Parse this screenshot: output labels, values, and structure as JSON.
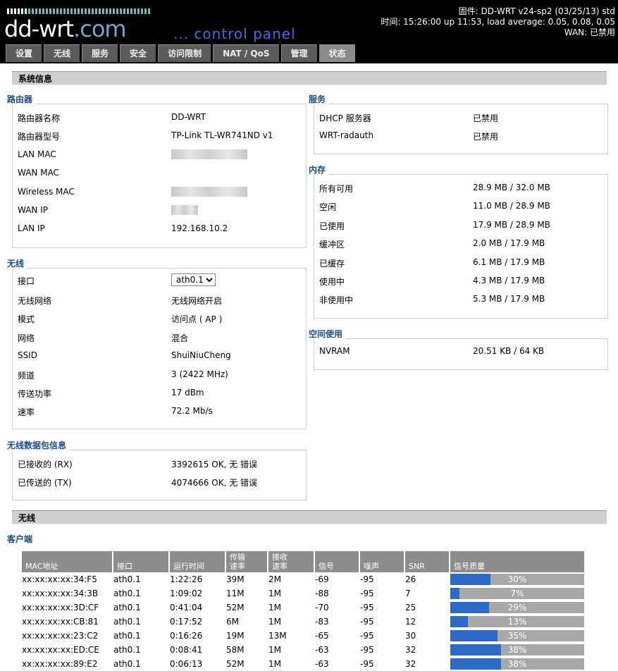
{
  "header": {
    "logo_main": "dd-wrt",
    "logo_com": ".com",
    "subtitle": "... control panel",
    "firmware": "固件: DD-WRT v24-sp2 (03/25/13) std",
    "time": "时间: 15:26:00 up 11:53, load average: 0.05, 0.08, 0.05",
    "wan": "WAN: 已禁用"
  },
  "tabs": [
    "设置",
    "无线",
    "服务",
    "安全",
    "访问限制",
    "NAT / QoS",
    "管理",
    "状态"
  ],
  "system_info_title": "系统信息",
  "router": {
    "title": "路由器",
    "rows": [
      {
        "k": "路由器名称",
        "v": "DD-WRT"
      },
      {
        "k": "路由器型号",
        "v": "TP-Link TL-WR741ND v1"
      },
      {
        "k": "LAN MAC",
        "v": ""
      },
      {
        "k": "WAN MAC",
        "v": ""
      },
      {
        "k": "Wireless MAC",
        "v": ""
      },
      {
        "k": "WAN IP",
        "v": ""
      },
      {
        "k": "LAN IP",
        "v": "192.168.10.2"
      }
    ]
  },
  "wireless": {
    "title": "无线",
    "interface_label": "接口",
    "interface_value": "ath0.1",
    "rows": [
      {
        "k": "无线网络",
        "v": "无线网络开启"
      },
      {
        "k": "模式",
        "v": "访问点 ( AP )"
      },
      {
        "k": "网络",
        "v": "混合"
      },
      {
        "k": "SSID",
        "v": "ShuiNiuCheng"
      },
      {
        "k": "频道",
        "v": "3 (2422 MHz)"
      },
      {
        "k": "传送功率",
        "v": "17 dBm"
      },
      {
        "k": "速率",
        "v": "72.2 Mb/s"
      }
    ]
  },
  "packets": {
    "title": "无线数据包信息",
    "rows": [
      {
        "k": "已接收的 (RX)",
        "v": "3392615 OK, 无 错误"
      },
      {
        "k": "已传送的 (TX)",
        "v": "4074666 OK, 无 错误"
      }
    ]
  },
  "services": {
    "title": "服务",
    "rows": [
      {
        "k": "DHCP 服务器",
        "v": "已禁用"
      },
      {
        "k": "WRT-radauth",
        "v": "已禁用"
      }
    ]
  },
  "memory": {
    "title": "内存",
    "rows": [
      {
        "k": "所有可用",
        "v": "28.9 MB / 32.0 MB"
      },
      {
        "k": "空闲",
        "v": "11.0 MB / 28.9 MB"
      },
      {
        "k": "已使用",
        "v": "17.9 MB / 28.9 MB"
      },
      {
        "k": "缓冲区",
        "v": "2.0 MB / 17.9 MB"
      },
      {
        "k": "已缓存",
        "v": "6.1 MB / 17.9 MB"
      },
      {
        "k": "使用中",
        "v": "4.3 MB / 17.9 MB"
      },
      {
        "k": "非使用中",
        "v": "5.3 MB / 17.9 MB"
      }
    ]
  },
  "space": {
    "title": "空间使用",
    "rows": [
      {
        "k": "NVRAM",
        "v": "20.51 KB / 64 KB"
      }
    ]
  },
  "wireless_section_title": "无线",
  "clients": {
    "title": "客户端",
    "columns": [
      "MAC地址",
      "接口",
      "运行时间",
      "传输\n速率",
      "接收\n速率",
      "信号",
      "噪声",
      "SNR",
      "信号质量"
    ],
    "rows": [
      {
        "mac": "xx:xx:xx:xx:34:F5",
        "iface": "ath0.1",
        "uptime": "1:22:26",
        "tx": "39M",
        "rx": "2M",
        "signal": "-69",
        "noise": "-95",
        "snr": "26",
        "quality": 30
      },
      {
        "mac": "xx:xx:xx:xx:34:3B",
        "iface": "ath0.1",
        "uptime": "1:09:02",
        "tx": "11M",
        "rx": "1M",
        "signal": "-88",
        "noise": "-95",
        "snr": "7",
        "quality": 7
      },
      {
        "mac": "xx:xx:xx:xx:3D:CF",
        "iface": "ath0.1",
        "uptime": "0:41:04",
        "tx": "52M",
        "rx": "1M",
        "signal": "-70",
        "noise": "-95",
        "snr": "25",
        "quality": 29
      },
      {
        "mac": "xx:xx:xx:xx:CB:81",
        "iface": "ath0.1",
        "uptime": "0:17:52",
        "tx": "6M",
        "rx": "1M",
        "signal": "-83",
        "noise": "-95",
        "snr": "12",
        "quality": 13
      },
      {
        "mac": "xx:xx:xx:xx:23:C2",
        "iface": "ath0.1",
        "uptime": "0:16:26",
        "tx": "19M",
        "rx": "13M",
        "signal": "-65",
        "noise": "-95",
        "snr": "30",
        "quality": 35
      },
      {
        "mac": "xx:xx:xx:xx:ED:CE",
        "iface": "ath0.1",
        "uptime": "0:08:41",
        "tx": "58M",
        "rx": "1M",
        "signal": "-63",
        "noise": "-95",
        "snr": "32",
        "quality": 38
      },
      {
        "mac": "xx:xx:xx:xx:89:E2",
        "iface": "ath0.1",
        "uptime": "0:06:13",
        "tx": "52M",
        "rx": "1M",
        "signal": "-63",
        "noise": "-95",
        "snr": "32",
        "quality": 38
      }
    ]
  },
  "colors": {
    "accent": "#1e4a8a",
    "quality_fill": "#2e6ac7",
    "header_bg": "#000000"
  }
}
